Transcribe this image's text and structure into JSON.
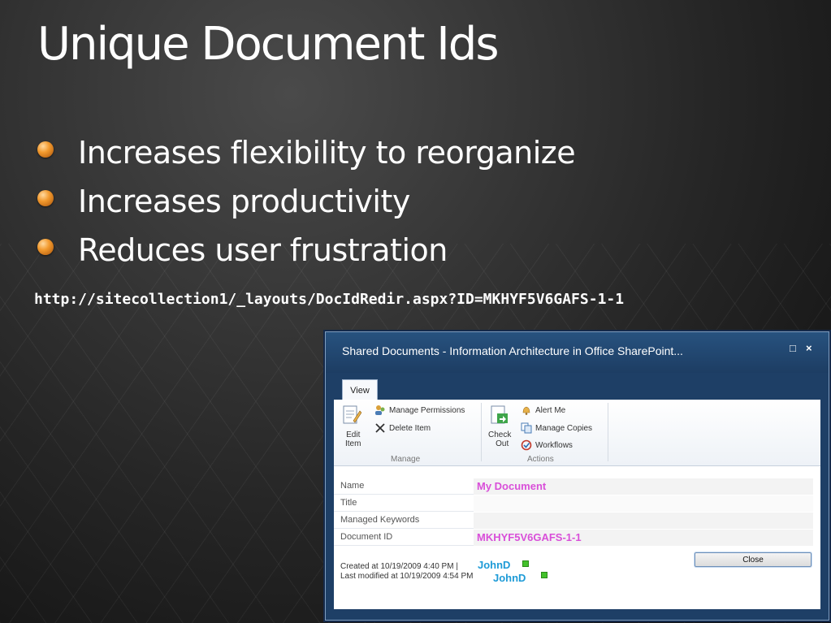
{
  "slide": {
    "title": "Unique Document Ids",
    "bullets": [
      "Increases flexibility to reorganize",
      "Increases productivity",
      "Reduces user frustration"
    ],
    "url": "http://sitecollection1/_layouts/DocIdRedir.aspx?ID=MKHYF5V6GAFS-1-1"
  },
  "dialog": {
    "title": "Shared Documents - Information Architecture in Office SharePoint...",
    "maximize_glyph": "□",
    "close_glyph": "×",
    "tab": "View",
    "ribbon": {
      "manage": {
        "edit_item_line1": "Edit",
        "edit_item_line2": "Item",
        "manage_permissions": "Manage Permissions",
        "delete_item": "Delete Item",
        "group_label": "Manage"
      },
      "actions": {
        "check_out_line1": "Check",
        "check_out_line2": "Out",
        "alert_me": "Alert Me",
        "manage_copies": "Manage Copies",
        "workflows": "Workflows",
        "group_label": "Actions"
      }
    },
    "fields": [
      {
        "label": "Name",
        "value": "My Document"
      },
      {
        "label": "Title",
        "value": ""
      },
      {
        "label": "Managed Keywords",
        "value": ""
      },
      {
        "label": "Document ID",
        "value": "MKHYF5V6GAFS-1-1"
      }
    ],
    "created": "Created at 10/19/2009 4:40 PM  |",
    "modified": "Last modified at 10/19/2009 4:54 PM",
    "created_by": "JohnD",
    "modified_by": "JohnD",
    "close_button": "Close",
    "colors": {
      "highlight_pink": "#d94fd9",
      "user_blue": "#1e9bd7",
      "presence_green": "#43c12b",
      "dialog_blue": "#1e3f66"
    }
  }
}
